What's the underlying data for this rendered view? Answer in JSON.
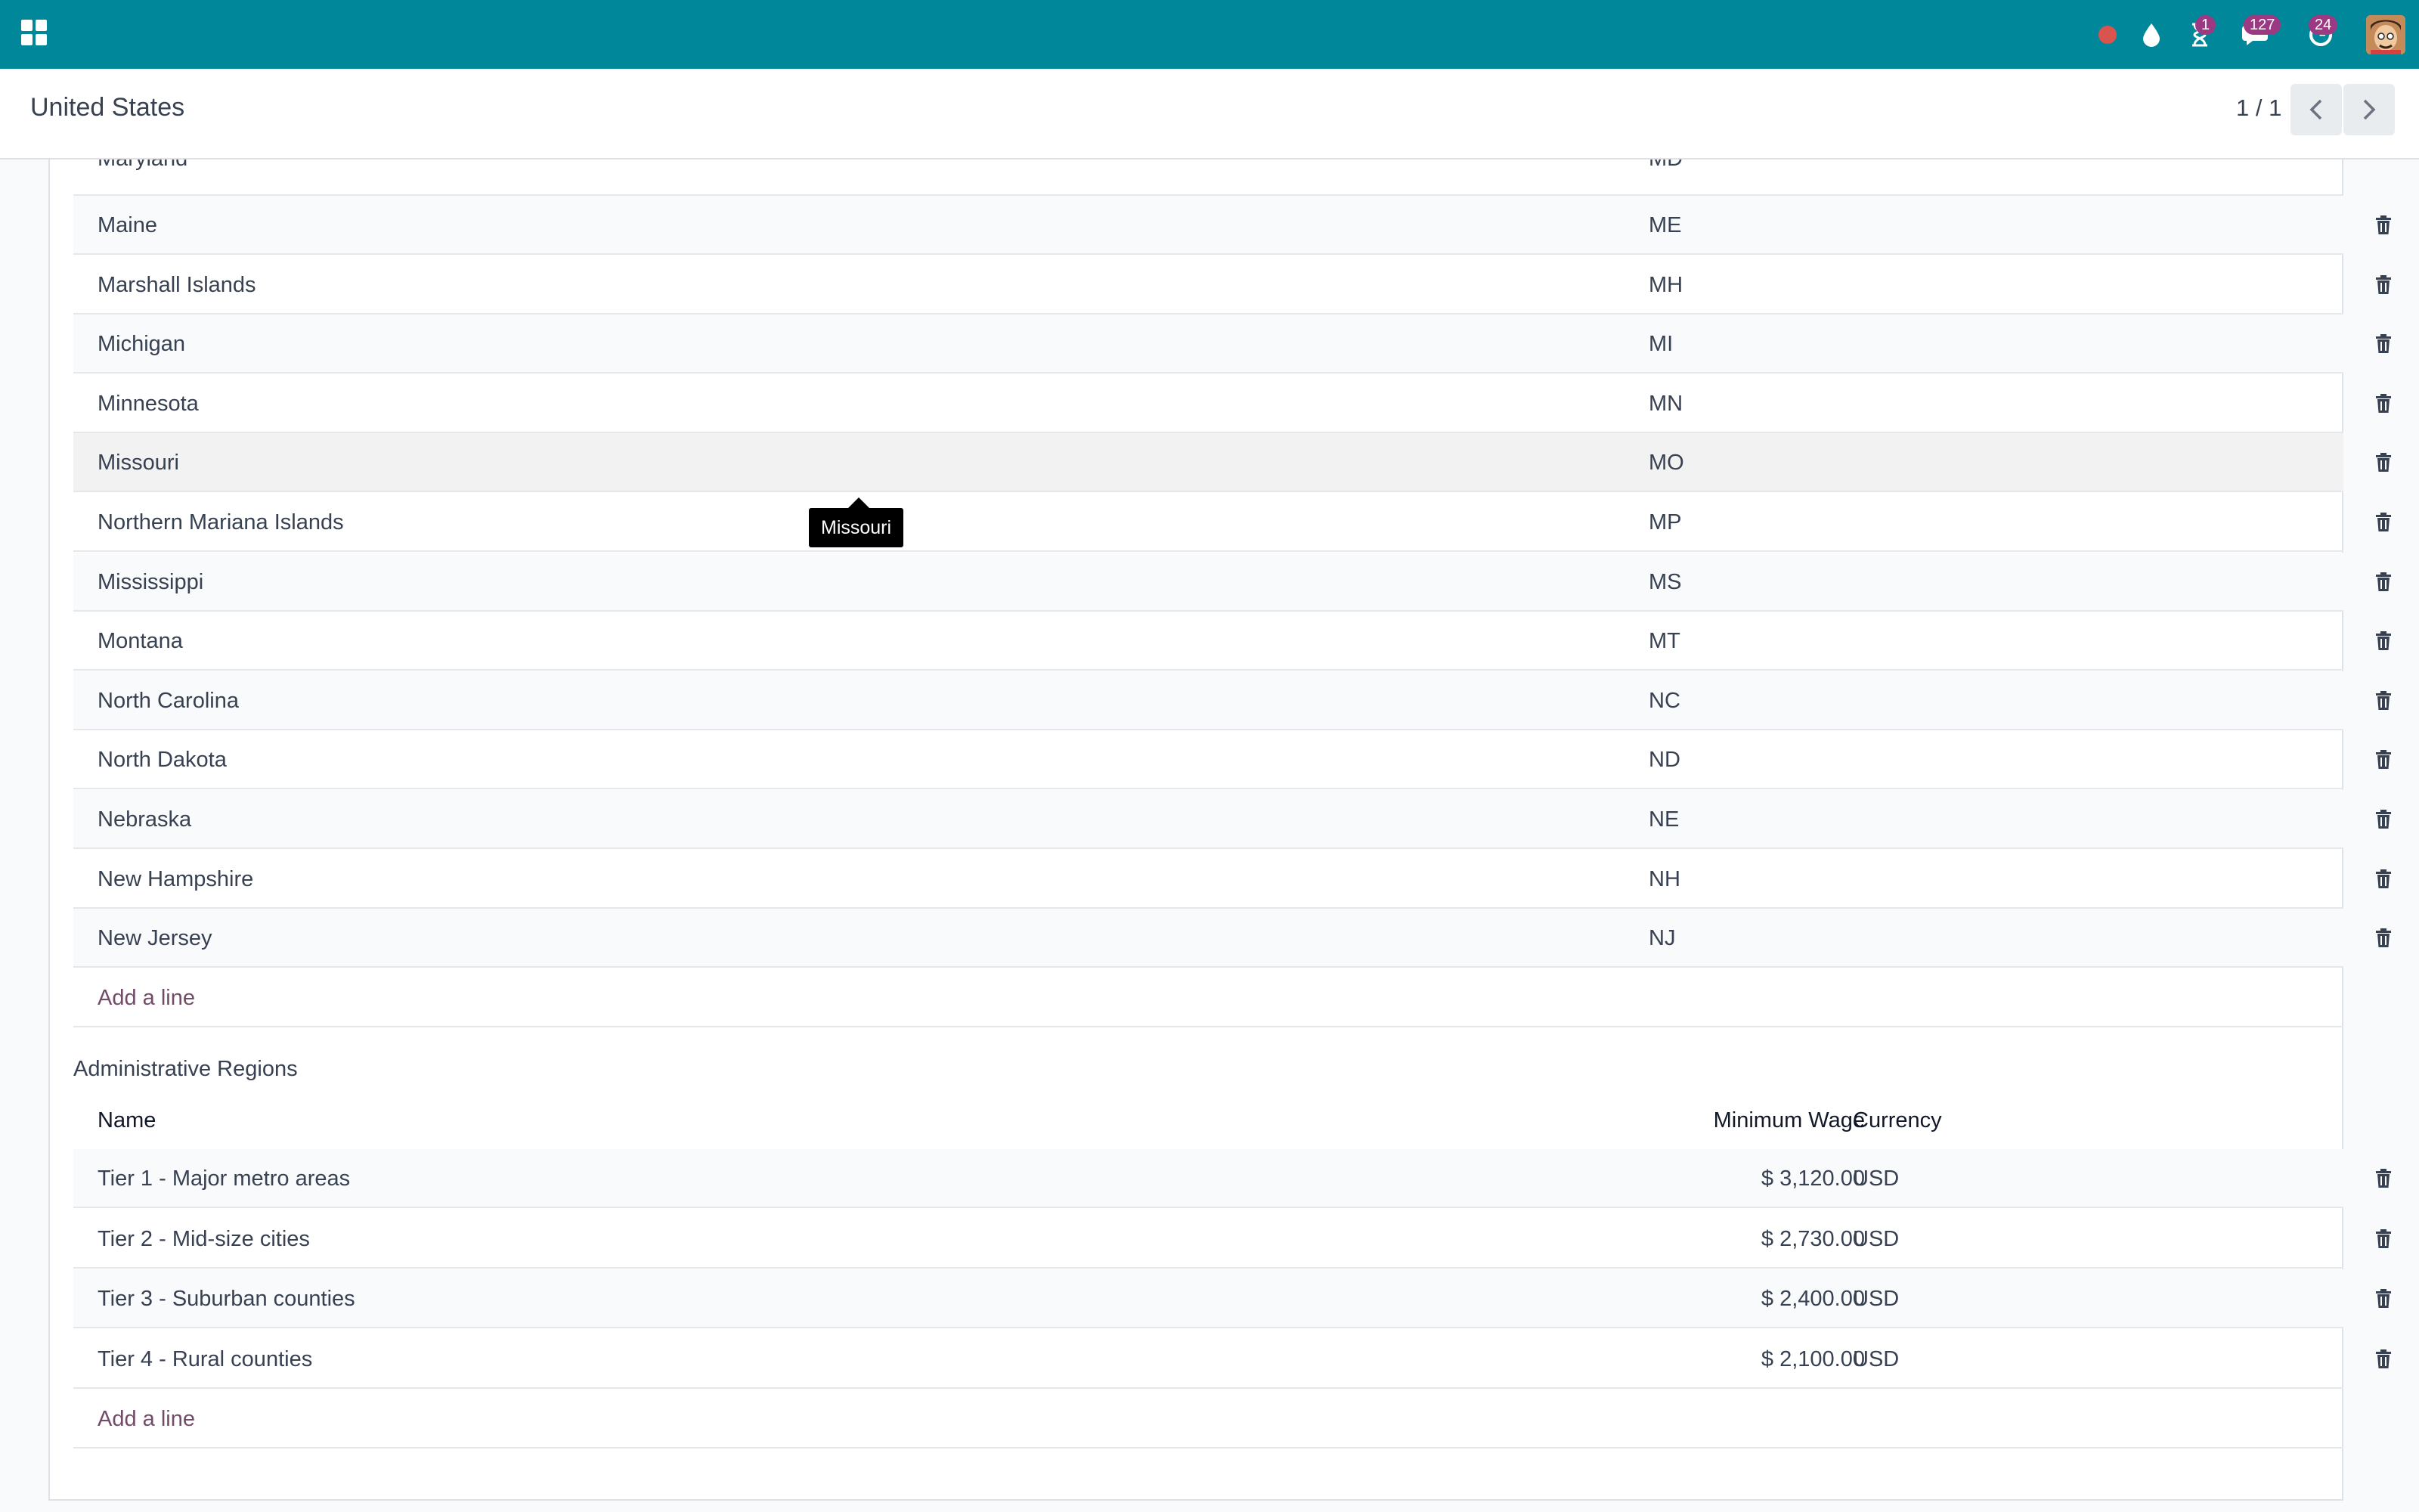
{
  "navbar": {
    "apps_icon": "apps-grid-icon",
    "systray": [
      {
        "name": "recording-dot-icon",
        "badge": ""
      },
      {
        "name": "droplet-icon",
        "badge": ""
      },
      {
        "name": "hourglass-icon",
        "badge": "1"
      },
      {
        "name": "messages-icon",
        "badge": "127"
      },
      {
        "name": "activity-clock-icon",
        "badge": "24"
      }
    ],
    "accent": "#00879a",
    "badge_color": "#9b3a82"
  },
  "control_panel": {
    "title": "United States",
    "pager": "1 / 1"
  },
  "states_table": {
    "partial_row": {
      "name": "Maryland",
      "code": "MD"
    },
    "rows": [
      {
        "name": "Maine",
        "code": "ME"
      },
      {
        "name": "Marshall Islands",
        "code": "MH"
      },
      {
        "name": "Michigan",
        "code": "MI"
      },
      {
        "name": "Minnesota",
        "code": "MN"
      },
      {
        "name": "Missouri",
        "code": "MO"
      },
      {
        "name": "Northern Mariana Islands",
        "code": "MP"
      },
      {
        "name": "Mississippi",
        "code": "MS"
      },
      {
        "name": "Montana",
        "code": "MT"
      },
      {
        "name": "North Carolina",
        "code": "NC"
      },
      {
        "name": "North Dakota",
        "code": "ND"
      },
      {
        "name": "Nebraska",
        "code": "NE"
      },
      {
        "name": "New Hampshire",
        "code": "NH"
      },
      {
        "name": "New Jersey",
        "code": "NJ"
      }
    ],
    "add_line": "Add a line",
    "tooltip": "Missouri"
  },
  "regions": {
    "section_label": "Administrative Regions",
    "headers": {
      "name": "Name",
      "wage": "Minimum Wage",
      "currency": "Currency"
    },
    "rows": [
      {
        "name": "Tier 1 - Major metro areas",
        "wage": "$ 3,120.00",
        "currency": "USD"
      },
      {
        "name": "Tier 2 - Mid-size cities",
        "wage": "$ 2,730.00",
        "currency": "USD"
      },
      {
        "name": "Tier 3 - Suburban counties",
        "wage": "$ 2,400.00",
        "currency": "USD"
      },
      {
        "name": "Tier 4 - Rural counties",
        "wage": "$ 2,100.00",
        "currency": "USD"
      }
    ],
    "add_line": "Add a line"
  }
}
